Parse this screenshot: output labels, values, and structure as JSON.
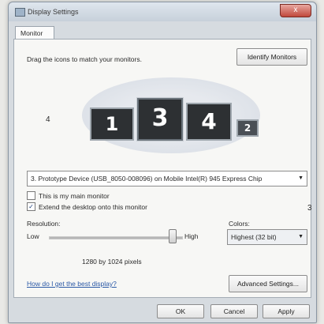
{
  "window": {
    "title": "Display Settings",
    "close_glyph": "x",
    "close_icon": "close-icon",
    "app_icon": "display-settings-icon"
  },
  "tab": {
    "label": "Monitor"
  },
  "monitor": {
    "instruction": "Drag the icons to match your monitors.",
    "identify_label": "Identify Monitors",
    "monitors": [
      "1",
      "3",
      "4",
      "2"
    ],
    "left_label": "4",
    "right_label": "3",
    "device": "3. Prototype Device (USB_8050-008096) on Mobile Intel(R) 945 Express Chip",
    "dropdown_arrow": "▼",
    "main_monitor_label": "This is my main monitor",
    "main_monitor_checked": false,
    "extend_label": "Extend the desktop onto this monitor",
    "extend_checked": true,
    "extend_mark": "✓"
  },
  "resolution": {
    "label": "Resolution:",
    "low": "Low",
    "high": "High",
    "value_text": "1280 by 1024 pixels",
    "slider_fraction": 0.95
  },
  "colors": {
    "label": "Colors:",
    "value": "Highest (32 bit)"
  },
  "links": {
    "help": "How do I get the best display?"
  },
  "buttons": {
    "advanced": "Advanced Settings...",
    "ok": "OK",
    "cancel": "Cancel",
    "apply": "Apply"
  }
}
